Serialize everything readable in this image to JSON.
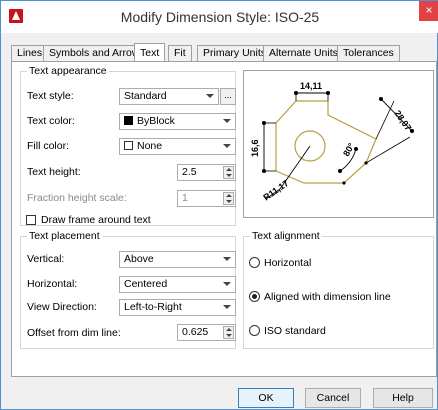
{
  "window": {
    "title": "Modify Dimension Style: ISO-25",
    "close_label": "×"
  },
  "tabs": [
    {
      "label": "Lines"
    },
    {
      "label": "Symbols and Arrows"
    },
    {
      "label": "Text"
    },
    {
      "label": "Fit"
    },
    {
      "label": "Primary Units"
    },
    {
      "label": "Alternate Units"
    },
    {
      "label": "Tolerances"
    }
  ],
  "active_tab": "Text",
  "text_appearance": {
    "title": "Text appearance",
    "text_style_label": "Text style:",
    "text_style_value": "Standard",
    "text_style_browse": "...",
    "text_color_label": "Text color:",
    "text_color_value": "ByBlock",
    "fill_color_label": "Fill color:",
    "fill_color_value": "None",
    "text_height_label": "Text height:",
    "text_height_value": "2.5",
    "fraction_scale_label": "Fraction height scale:",
    "fraction_scale_value": "1",
    "draw_frame_label": "Draw frame around text"
  },
  "text_placement": {
    "title": "Text placement",
    "vertical_label": "Vertical:",
    "vertical_value": "Above",
    "horizontal_label": "Horizontal:",
    "horizontal_value": "Centered",
    "view_direction_label": "View Direction:",
    "view_direction_value": "Left-to-Right",
    "offset_label": "Offset from dim line:",
    "offset_value": "0.625"
  },
  "text_alignment": {
    "title": "Text alignment",
    "options": [
      {
        "label": "Horizontal",
        "selected": false
      },
      {
        "label": "Aligned with dimension line",
        "selected": true
      },
      {
        "label": "ISO standard",
        "selected": false
      }
    ]
  },
  "preview": {
    "dim_top": "14,11",
    "dim_left": "16,6",
    "dim_right": "28,07",
    "dim_angle": "80°",
    "dim_radius": "R11,17"
  },
  "buttons": {
    "ok": "OK",
    "cancel": "Cancel",
    "help": "Help"
  },
  "colors": {
    "accent": "#4f8fd8",
    "close": "#e04343",
    "preview_shape": "#b8a040"
  }
}
